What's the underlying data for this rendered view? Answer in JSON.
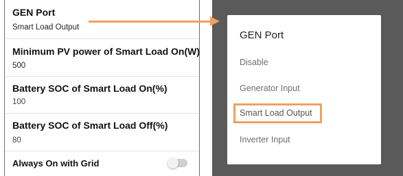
{
  "settings": {
    "gen_port": {
      "title": "GEN Port",
      "value": "Smart Load Output"
    },
    "min_pv_power": {
      "title": "Minimum PV power of Smart Load On(W)",
      "value": "500"
    },
    "battery_soc_on": {
      "title": "Battery SOC of Smart Load On(%)",
      "value": "100"
    },
    "battery_soc_off": {
      "title": "Battery SOC of Smart Load Off(%)",
      "value": "80"
    },
    "always_on_with_grid": {
      "title": "Always On with Grid",
      "enabled": false
    }
  },
  "dropdown": {
    "title": "GEN Port",
    "options": [
      "Disable",
      "Generator Input",
      "Smart Load Output",
      "Inverter Input"
    ],
    "selected": "Smart Load Output"
  },
  "colors": {
    "accent": "#f0a060",
    "overlay": "#5a5a5a"
  }
}
